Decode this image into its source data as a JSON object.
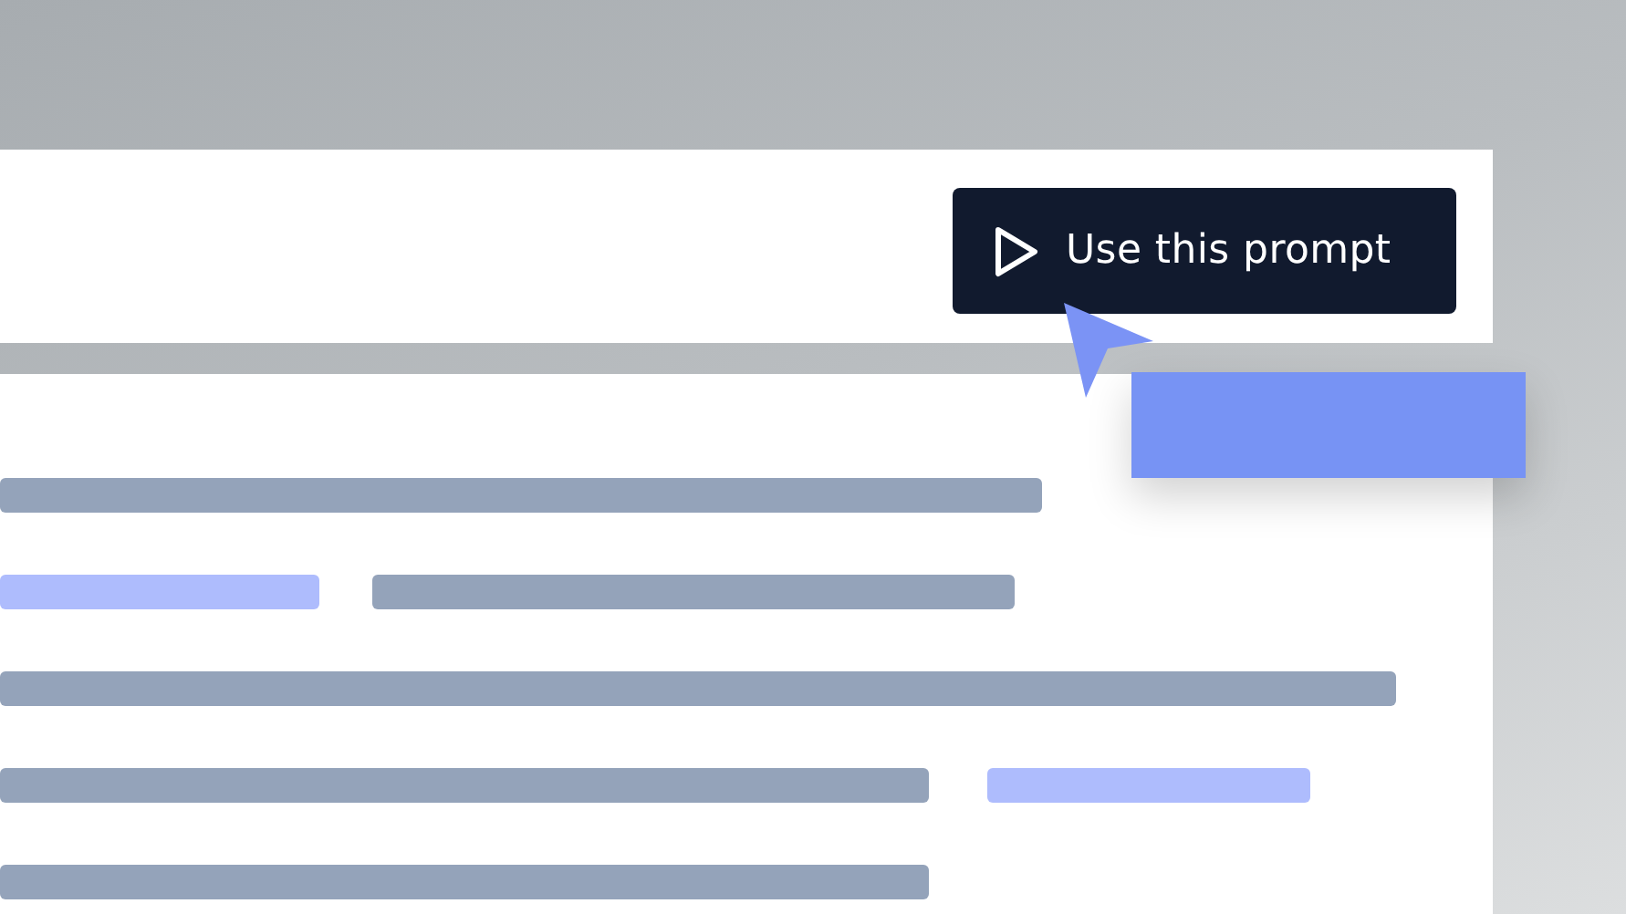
{
  "prompt_button": {
    "label": "Use this prompt"
  },
  "text_lines": [
    {
      "segments": [
        {
          "color": "#94a3ba"
        }
      ]
    },
    {
      "segments": [
        {
          "color": "#aebcfd"
        },
        {
          "color": "#94a3ba"
        }
      ]
    },
    {
      "segments": [
        {
          "color": "#94a3ba"
        }
      ]
    },
    {
      "segments": [
        {
          "color": "#94a3ba"
        },
        {
          "color": "#aebcfd"
        }
      ]
    },
    {
      "segments": [
        {
          "color": "#94a3ba"
        }
      ]
    }
  ]
}
